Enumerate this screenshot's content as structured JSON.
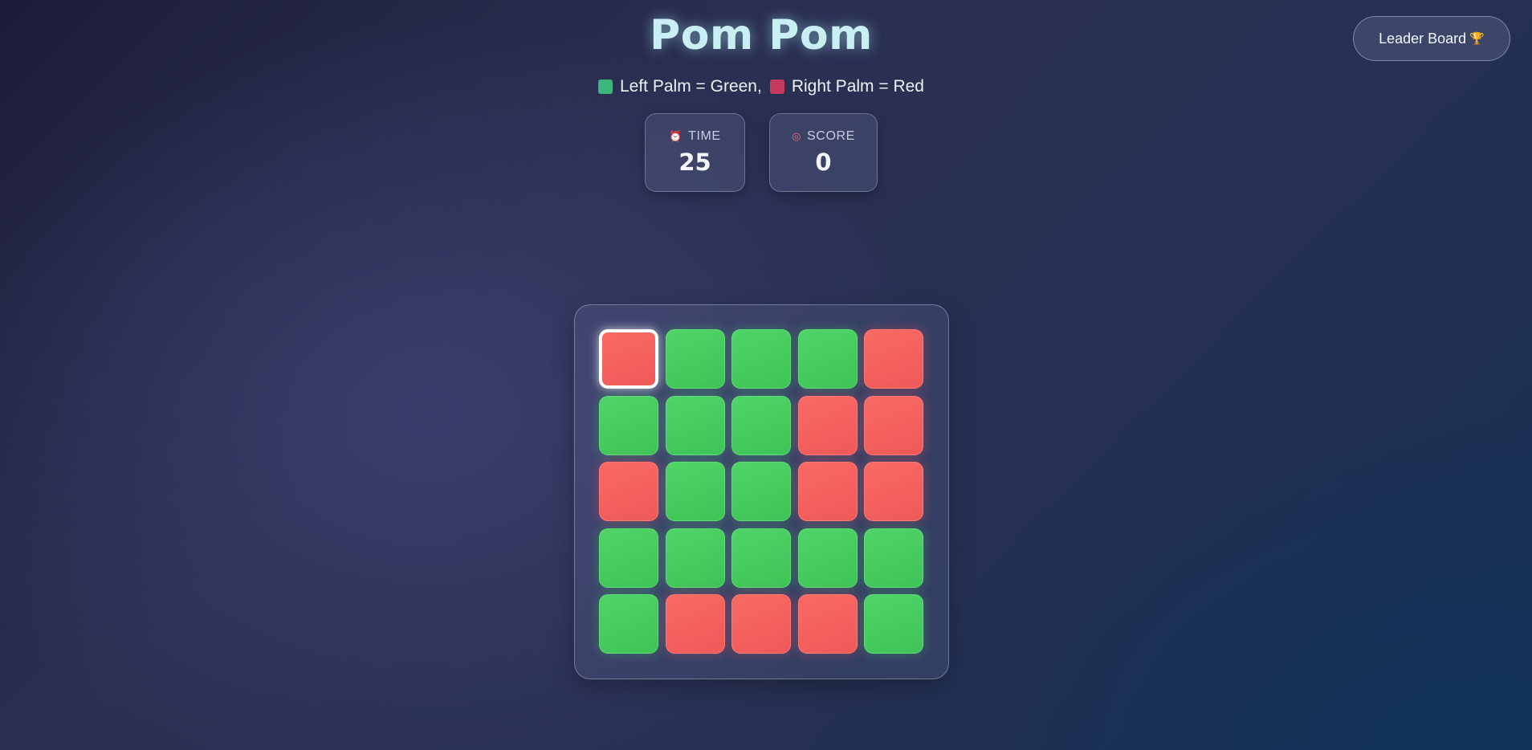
{
  "title": "Pom Pom",
  "leaderboard": {
    "label": "Leader Board",
    "icon": "trophy-icon",
    "icon_glyph": "🏆"
  },
  "legend": {
    "left": {
      "label": "Left Palm = Green,",
      "color": "#3cb57e"
    },
    "right": {
      "label": "Right Palm = Red",
      "color": "#c83a60"
    }
  },
  "stats": {
    "time": {
      "label": "TIME",
      "value": "25",
      "icon": "alarm-clock-icon"
    },
    "score": {
      "label": "SCORE",
      "value": "0",
      "icon": "target-icon"
    }
  },
  "board": {
    "rows": 5,
    "cols": 5,
    "selected": [
      0,
      0
    ],
    "colors": {
      "green": "#46cc5e",
      "red": "#f46260"
    },
    "cells": [
      [
        "red",
        "green",
        "green",
        "green",
        "red"
      ],
      [
        "green",
        "green",
        "green",
        "red",
        "red"
      ],
      [
        "red",
        "green",
        "green",
        "red",
        "red"
      ],
      [
        "green",
        "green",
        "green",
        "green",
        "green"
      ],
      [
        "green",
        "red",
        "red",
        "red",
        "green"
      ]
    ]
  }
}
